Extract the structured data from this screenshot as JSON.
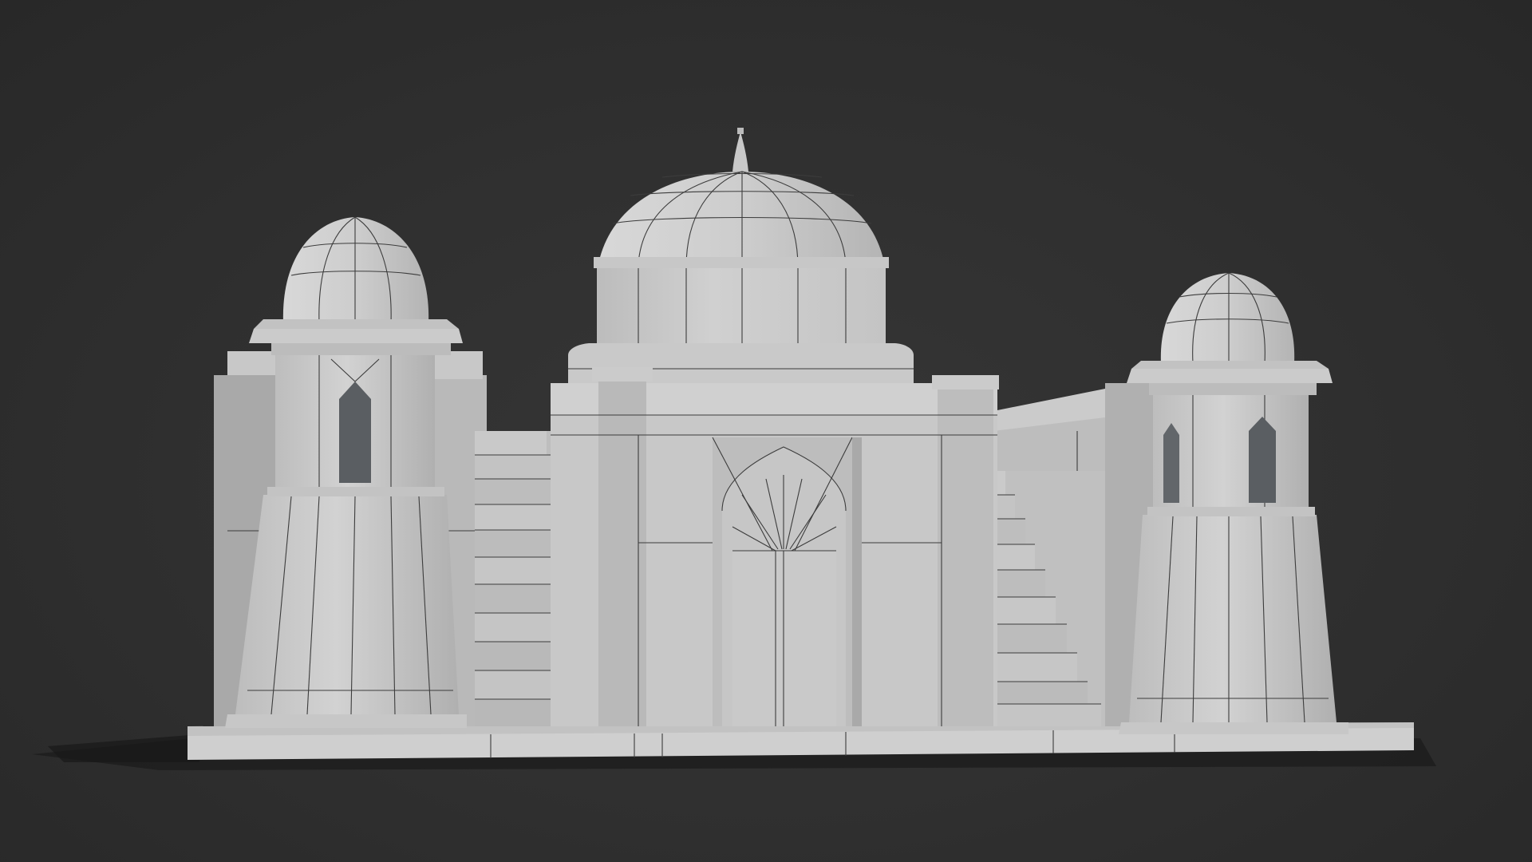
{
  "scene": {
    "subject": "untextured-3d-model",
    "colors": {
      "background": "#2e2e2e",
      "model_light": "#cfcfcf",
      "model_mid": "#b7b7b7",
      "model_shadow": "#a2a2a2",
      "model_dark": "#8d8d8d",
      "opening": "#5a5e62",
      "wireframe": "#3c3c3c",
      "ground_shadow": "#1d1d1d"
    },
    "wireframe_visible": true
  }
}
